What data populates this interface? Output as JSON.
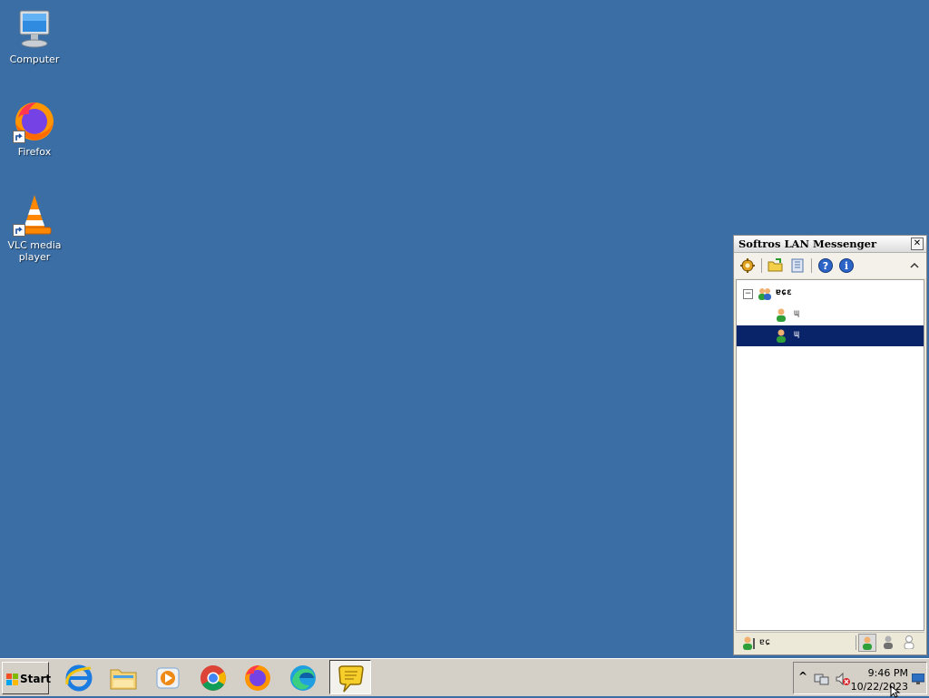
{
  "desktop": {
    "icons": [
      {
        "label": "Computer"
      },
      {
        "label": "Firefox"
      },
      {
        "label": "VLC media\nplayer"
      }
    ]
  },
  "messenger": {
    "title": "Softros LAN Messenger",
    "close_label": "✕",
    "tree": {
      "group_label": "ɐɕɛ",
      "user1_label": "ɰ",
      "user2_label": "ɰ"
    },
    "status_label": "ɐɕ"
  },
  "taskbar": {
    "start_label": "Start",
    "apps": [
      "internet-explorer-icon",
      "file-explorer-icon",
      "media-player-icon",
      "chrome-icon",
      "firefox-icon",
      "edge-icon",
      "softros-messenger-icon"
    ]
  },
  "tray": {
    "time": "9:46 PM",
    "date": "10/22/2023",
    "expand_label": "^"
  },
  "colors": {
    "desktop": "#3a6ea5",
    "selection": "#0a246a"
  }
}
